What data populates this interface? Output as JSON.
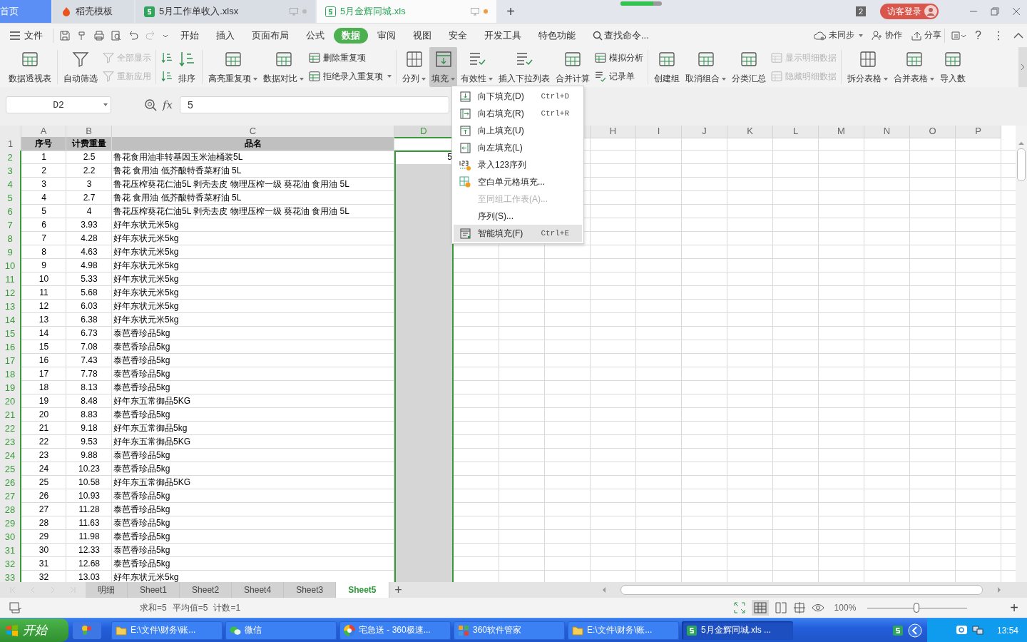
{
  "title_bar": {
    "tabs": [
      {
        "label": "首页",
        "kind": "home",
        "selected": false
      },
      {
        "label": "稻壳模板",
        "kind": "docer",
        "selected": false
      },
      {
        "label": "5月工作单收入.xlsx",
        "kind": "sheet",
        "selected": false,
        "modified": false
      },
      {
        "label": "5月金辉同城.xls",
        "kind": "sheet",
        "selected": true,
        "modified": true
      }
    ],
    "add": "+",
    "progress": {
      "level": 0.8
    },
    "window_count": "2",
    "login": "访客登录"
  },
  "menu_bar": {
    "file": "文件",
    "tabs": [
      {
        "label": "开始",
        "selected": false
      },
      {
        "label": "插入",
        "selected": false
      },
      {
        "label": "页面布局",
        "selected": false
      },
      {
        "label": "公式",
        "selected": false
      },
      {
        "label": "数据",
        "selected": true
      },
      {
        "label": "审阅",
        "selected": false
      },
      {
        "label": "视图",
        "selected": false
      },
      {
        "label": "安全",
        "selected": false
      },
      {
        "label": "开发工具",
        "selected": false
      },
      {
        "label": "特色功能",
        "selected": false
      }
    ],
    "search": "查找命令...",
    "sync": "未同步",
    "collaborate": "协作",
    "share": "分享",
    "help": "?",
    "more": "⋮"
  },
  "ribbon": {
    "groups": [
      {
        "items": [
          {
            "kind": "large",
            "label": "数据透视表",
            "dropdown": false,
            "disabled": false,
            "pressed": false
          }
        ]
      },
      {
        "items": [
          {
            "kind": "large",
            "label": "自动筛选",
            "dropdown": false,
            "disabled": false,
            "pressed": false
          },
          {
            "kind": "stack",
            "items": [
              {
                "kind": "small",
                "label": "全部显示",
                "dropdown": false,
                "disabled": true
              },
              {
                "kind": "small",
                "label": "重新应用",
                "dropdown": false,
                "disabled": true
              }
            ]
          }
        ]
      },
      {
        "items": [
          {
            "kind": "stack",
            "items": [
              {
                "kind": "icon",
                "dropdown": false,
                "disabled": false
              },
              {
                "kind": "icon",
                "dropdown": false,
                "disabled": false
              }
            ]
          },
          {
            "kind": "large",
            "label": "排序",
            "dropdown": false,
            "disabled": false,
            "pressed": false
          }
        ]
      },
      {
        "items": [
          {
            "kind": "large",
            "label": "高亮重复项",
            "dropdown": true,
            "disabled": false,
            "pressed": false
          },
          {
            "kind": "large",
            "label": "数据对比",
            "dropdown": true,
            "disabled": false,
            "pressed": false
          },
          {
            "kind": "stack",
            "items": [
              {
                "kind": "small",
                "label": "删除重复项",
                "dropdown": false,
                "disabled": false
              },
              {
                "kind": "small",
                "label": "拒绝录入重复项",
                "dropdown": true,
                "disabled": false
              }
            ]
          }
        ]
      },
      {
        "items": [
          {
            "kind": "large",
            "label": "分列",
            "dropdown": true,
            "disabled": false,
            "pressed": false
          },
          {
            "kind": "large",
            "label": "填充",
            "dropdown": true,
            "disabled": false,
            "pressed": true
          },
          {
            "kind": "large",
            "label": "有效性",
            "dropdown": true,
            "disabled": false,
            "pressed": false
          },
          {
            "kind": "large",
            "label": "插入下拉列表",
            "dropdown": false,
            "disabled": false,
            "pressed": false
          },
          {
            "kind": "large",
            "label": "合并计算",
            "dropdown": false,
            "disabled": false,
            "pressed": false
          },
          {
            "kind": "stack",
            "items": [
              {
                "kind": "small",
                "label": "模拟分析",
                "dropdown": false,
                "disabled": false
              },
              {
                "kind": "small",
                "label": "记录单",
                "dropdown": false,
                "disabled": false
              }
            ]
          }
        ]
      },
      {
        "items": [
          {
            "kind": "large",
            "label": "创建组",
            "dropdown": false,
            "disabled": false,
            "pressed": false
          },
          {
            "kind": "large",
            "label": "取消组合",
            "dropdown": true,
            "disabled": false,
            "pressed": false
          },
          {
            "kind": "large",
            "label": "分类汇总",
            "dropdown": false,
            "disabled": false,
            "pressed": false
          },
          {
            "kind": "stack",
            "items": [
              {
                "kind": "small",
                "label": "显示明细数据",
                "dropdown": false,
                "disabled": true
              },
              {
                "kind": "small",
                "label": "隐藏明细数据",
                "dropdown": false,
                "disabled": true
              }
            ]
          }
        ]
      },
      {
        "items": [
          {
            "kind": "large",
            "label": "拆分表格",
            "dropdown": true,
            "disabled": false,
            "pressed": false
          },
          {
            "kind": "large",
            "label": "合并表格",
            "dropdown": true,
            "disabled": false,
            "pressed": false
          },
          {
            "kind": "large",
            "label": "导入数",
            "dropdown": false,
            "disabled": false,
            "pressed": false
          }
        ]
      }
    ]
  },
  "formula_bar": {
    "cell": "D2",
    "fx": "fx",
    "value": "5"
  },
  "sheet": {
    "columns": [
      {
        "kind": "letter",
        "letter": "A",
        "selected": false
      },
      {
        "kind": "letter",
        "letter": "B",
        "selected": false
      },
      {
        "kind": "letter",
        "letter": "C",
        "selected": false
      },
      {
        "kind": "letter",
        "letter": "D",
        "selected": true
      },
      {
        "kind": "covered"
      },
      {
        "kind": "covered"
      },
      {
        "kind": "covered"
      },
      {
        "kind": "letter",
        "letter": "H",
        "selected": false
      },
      {
        "kind": "letter",
        "letter": "I",
        "selected": false
      },
      {
        "kind": "letter",
        "letter": "J",
        "selected": false
      },
      {
        "kind": "letter",
        "letter": "K",
        "selected": false
      },
      {
        "kind": "letter",
        "letter": "L",
        "selected": false
      },
      {
        "kind": "letter",
        "letter": "M",
        "selected": false
      },
      {
        "kind": "letter",
        "letter": "N",
        "selected": false
      },
      {
        "kind": "letter",
        "letter": "O",
        "selected": false
      },
      {
        "kind": "letter",
        "letter": "P",
        "selected": false
      }
    ],
    "header_row": {
      "number": "1",
      "cells": [
        "序号",
        "计费重量",
        "品名"
      ]
    },
    "active_value": "5",
    "rows": [
      {
        "number": "2",
        "selected": true,
        "active": true,
        "cells": [
          "1",
          "2.5",
          "鲁花食用油非转基因玉米油桶装5L"
        ]
      },
      {
        "number": "3",
        "selected": true,
        "active": false,
        "cells": [
          "2",
          "2.2",
          "鲁花 食用油 低芥酸特香菜籽油 5L"
        ]
      },
      {
        "number": "4",
        "selected": true,
        "active": false,
        "cells": [
          "3",
          "3",
          "鲁花压榨葵花仁油5L 剥壳去皮 物理压榨一级 葵花油 食用油 5L"
        ]
      },
      {
        "number": "5",
        "selected": true,
        "active": false,
        "cells": [
          "4",
          "2.7",
          "鲁花 食用油 低芥酸特香菜籽油 5L"
        ]
      },
      {
        "number": "6",
        "selected": true,
        "active": false,
        "cells": [
          "5",
          "4",
          "鲁花压榨葵花仁油5L 剥壳去皮 物理压榨一级 葵花油 食用油 5L"
        ]
      },
      {
        "number": "7",
        "selected": true,
        "active": false,
        "cells": [
          "6",
          "3.93",
          "好年东状元米5kg"
        ]
      },
      {
        "number": "8",
        "selected": true,
        "active": false,
        "cells": [
          "7",
          "4.28",
          "好年东状元米5kg"
        ]
      },
      {
        "number": "9",
        "selected": true,
        "active": false,
        "cells": [
          "8",
          "4.63",
          "好年东状元米5kg"
        ]
      },
      {
        "number": "10",
        "selected": true,
        "active": false,
        "cells": [
          "9",
          "4.98",
          "好年东状元米5kg"
        ]
      },
      {
        "number": "11",
        "selected": true,
        "active": false,
        "cells": [
          "10",
          "5.33",
          "好年东状元米5kg"
        ]
      },
      {
        "number": "12",
        "selected": true,
        "active": false,
        "cells": [
          "11",
          "5.68",
          "好年东状元米5kg"
        ]
      },
      {
        "number": "13",
        "selected": true,
        "active": false,
        "cells": [
          "12",
          "6.03",
          "好年东状元米5kg"
        ]
      },
      {
        "number": "14",
        "selected": true,
        "active": false,
        "cells": [
          "13",
          "6.38",
          "好年东状元米5kg"
        ]
      },
      {
        "number": "15",
        "selected": true,
        "active": false,
        "cells": [
          "14",
          "6.73",
          "泰芭香珍品5kg"
        ]
      },
      {
        "number": "16",
        "selected": true,
        "active": false,
        "cells": [
          "15",
          "7.08",
          "泰芭香珍品5kg"
        ]
      },
      {
        "number": "17",
        "selected": true,
        "active": false,
        "cells": [
          "16",
          "7.43",
          "泰芭香珍品5kg"
        ]
      },
      {
        "number": "18",
        "selected": true,
        "active": false,
        "cells": [
          "17",
          "7.78",
          "泰芭香珍品5kg"
        ]
      },
      {
        "number": "19",
        "selected": true,
        "active": false,
        "cells": [
          "18",
          "8.13",
          "泰芭香珍品5kg"
        ]
      },
      {
        "number": "20",
        "selected": true,
        "active": false,
        "cells": [
          "19",
          "8.48",
          "好年东五常御品5KG"
        ]
      },
      {
        "number": "21",
        "selected": true,
        "active": false,
        "cells": [
          "20",
          "8.83",
          "泰芭香珍品5kg"
        ]
      },
      {
        "number": "22",
        "selected": true,
        "active": false,
        "cells": [
          "21",
          "9.18",
          "好年东五常御品5kg"
        ]
      },
      {
        "number": "23",
        "selected": true,
        "active": false,
        "cells": [
          "22",
          "9.53",
          "好年东五常御品5KG"
        ]
      },
      {
        "number": "24",
        "selected": true,
        "active": false,
        "cells": [
          "23",
          "9.88",
          "泰芭香珍品5kg"
        ]
      },
      {
        "number": "25",
        "selected": true,
        "active": false,
        "cells": [
          "24",
          "10.23",
          "泰芭香珍品5kg"
        ]
      },
      {
        "number": "26",
        "selected": true,
        "active": false,
        "cells": [
          "25",
          "10.58",
          "好年东五常御品5KG"
        ]
      },
      {
        "number": "27",
        "selected": true,
        "active": false,
        "cells": [
          "26",
          "10.93",
          "泰芭香珍品5kg"
        ]
      },
      {
        "number": "28",
        "selected": true,
        "active": false,
        "cells": [
          "27",
          "11.28",
          "泰芭香珍品5kg"
        ]
      },
      {
        "number": "29",
        "selected": true,
        "active": false,
        "cells": [
          "28",
          "11.63",
          "泰芭香珍品5kg"
        ]
      },
      {
        "number": "30",
        "selected": true,
        "active": false,
        "cells": [
          "29",
          "11.98",
          "泰芭香珍品5kg"
        ]
      },
      {
        "number": "31",
        "selected": true,
        "active": false,
        "cells": [
          "30",
          "12.33",
          "泰芭香珍品5kg"
        ]
      },
      {
        "number": "32",
        "selected": true,
        "active": false,
        "cells": [
          "31",
          "12.68",
          "泰芭香珍品5kg"
        ]
      },
      {
        "number": "33",
        "selected": true,
        "active": false,
        "cells": [
          "32",
          "13.03",
          "好年东状元米5kg"
        ]
      }
    ]
  },
  "fill_menu": {
    "items": [
      {
        "label": "向下填充(D)",
        "shortcut": "Ctrl+D",
        "disabled": false,
        "selected": false
      },
      {
        "label": "向右填充(R)",
        "shortcut": "Ctrl+R",
        "disabled": false,
        "selected": false
      },
      {
        "label": "向上填充(U)",
        "disabled": false,
        "selected": false
      },
      {
        "label": "向左填充(L)",
        "disabled": false,
        "selected": false
      },
      {
        "label": "录入123序列",
        "disabled": false,
        "selected": false
      },
      {
        "label": "空白单元格填充...",
        "disabled": false,
        "selected": false
      },
      {
        "label": "至同组工作表(A)...",
        "disabled": true,
        "selected": false
      },
      {
        "label": "序列(S)...",
        "disabled": false,
        "selected": false
      },
      {
        "label": "智能填充(F)",
        "shortcut": "Ctrl+E",
        "disabled": false,
        "selected": true
      }
    ]
  },
  "sheet_tabs": {
    "tabs": [
      {
        "label": "明细",
        "selected": false
      },
      {
        "label": "Sheet1",
        "selected": false
      },
      {
        "label": "Sheet2",
        "selected": false
      },
      {
        "label": "Sheet4",
        "selected": false
      },
      {
        "label": "Sheet3",
        "selected": false
      },
      {
        "label": "Sheet5",
        "selected": true
      }
    ],
    "add": "+"
  },
  "status_bar": {
    "stats": [
      "求和=5",
      "平均值=5",
      "计数=1"
    ],
    "zoom": "100%",
    "zoom_slider": {
      "level": 0.5
    },
    "zoom_in": "+"
  },
  "taskbar": {
    "start": "开始",
    "buttons": [
      {
        "label": "E:\\文件\\财务\\账...",
        "kind": "folder",
        "selected": false
      },
      {
        "label": "微信",
        "kind": "chat",
        "selected": false
      },
      {
        "label": "宅急送 - 360极速...",
        "kind": "browser",
        "selected": false
      },
      {
        "label": "360软件管家",
        "kind": "store",
        "selected": false
      },
      {
        "label": "E:\\文件\\财务\\账...",
        "kind": "folder",
        "selected": false
      },
      {
        "label": "5月金辉同城.xls ...",
        "kind": "wps",
        "selected": true
      }
    ],
    "clock": "13:54"
  }
}
